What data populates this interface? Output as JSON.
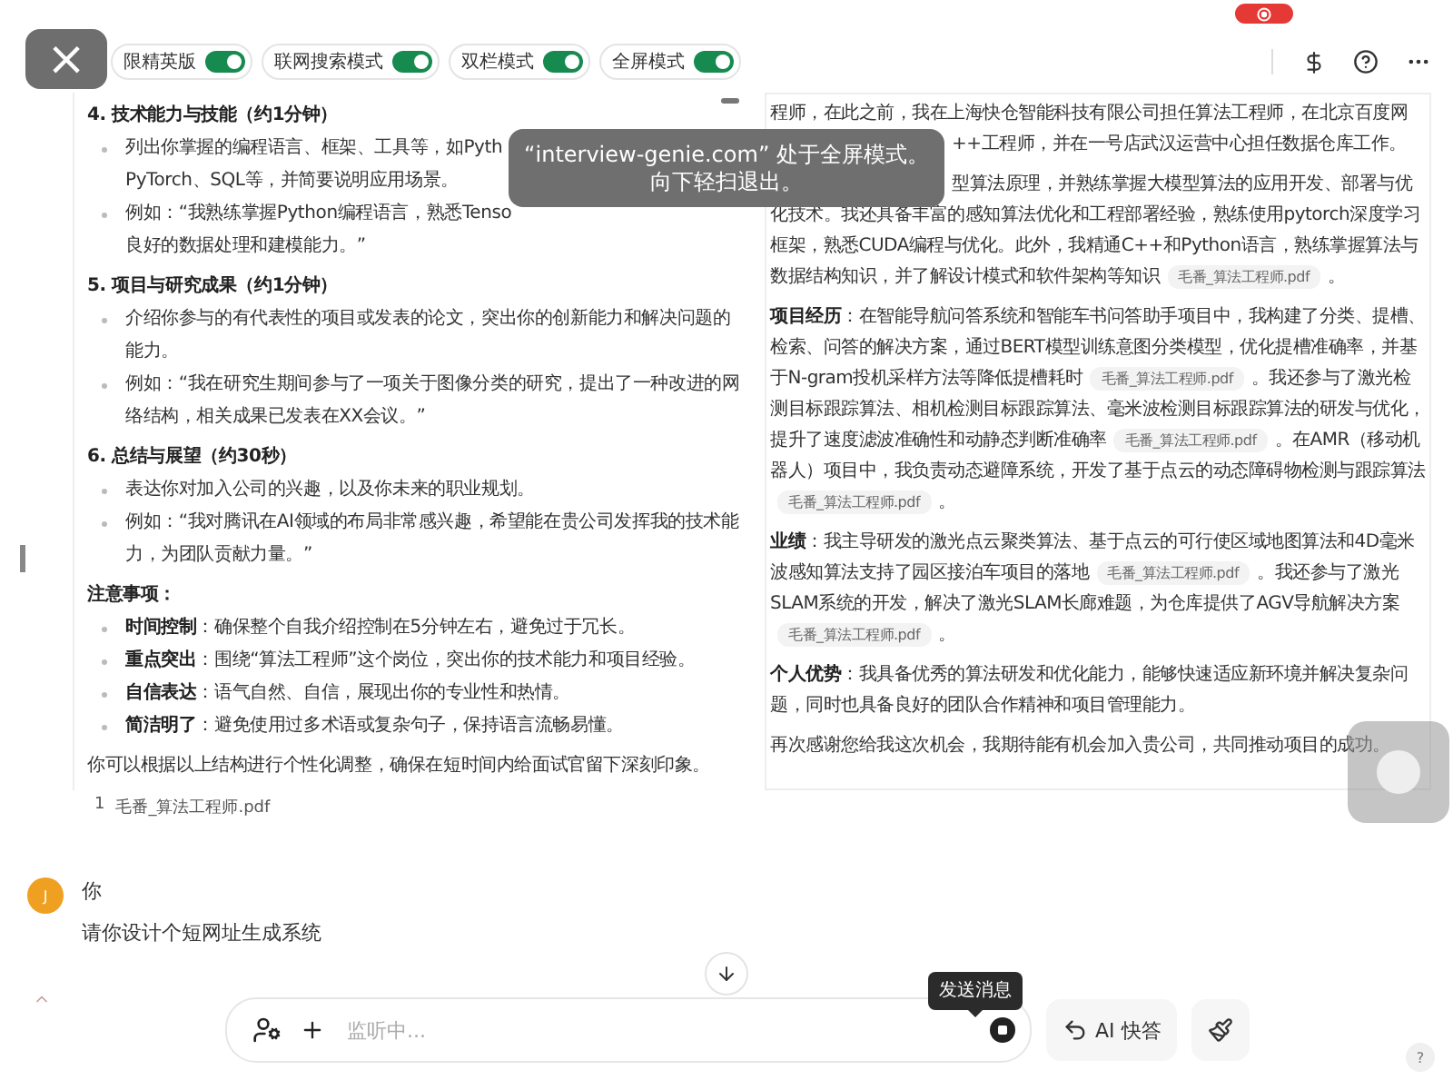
{
  "close_button": {
    "label": "×"
  },
  "toast": {
    "lines": [
      "“interview-genie.com” 处于全屏模式。",
      "向下轻扫退出。"
    ]
  },
  "toggles": [
    {
      "label": "限精英版",
      "on": true
    },
    {
      "label": "联网搜索模式",
      "on": true
    },
    {
      "label": "双栏模式",
      "on": true
    },
    {
      "label": "全屏模式",
      "on": true
    }
  ],
  "left_panel": {
    "sections": [
      {
        "heading": "4. 技术能力与技能（约1分钟）",
        "items": [
          {
            "text": "列出你掌握的编程语言、框架、工具等，如Pyth\nPyTorch、SQL等，并简要说明应用场景。"
          },
          {
            "text": "例如：“我熟练掌握Python编程语言，熟悉Tenso\n良好的数据处理和建模能力。”"
          }
        ]
      },
      {
        "heading": "5. 项目与研究成果（约1分钟）",
        "items": [
          {
            "text": "介绍你参与的有代表性的项目或发表的论文，突出你的创新能力和解决问题的能力。"
          },
          {
            "text": "例如：“我在研究生期间参与了一项关于图像分类的研究，提出了一种改进的网络结构，相关成果已发表在XX会议。”"
          }
        ]
      },
      {
        "heading": "6. 总结与展望（约30秒）",
        "items": [
          {
            "text": "表达你对加入公司的兴趣，以及你未来的职业规划。"
          },
          {
            "text": "例如：“我对腾讯在AI领域的布局非常感兴趣，希望能在贵公司发挥我的技术能力，为团队贡献力量。”"
          }
        ]
      },
      {
        "heading": "注意事项：",
        "items": [
          {
            "label": "时间控制",
            "text": "：确保整个自我介绍控制在5分钟左右，避免过于冗长。"
          },
          {
            "label": "重点突出",
            "text": "：围绕“算法工程师”这个岗位，突出你的技术能力和项目经验。"
          },
          {
            "label": "自信表达",
            "text": "：语气自然、自信，展现出你的专业性和热情。"
          },
          {
            "label": "简洁明了",
            "text": "：避免使用过多术语或复杂句子，保持语言流畅易懂。"
          }
        ]
      }
    ],
    "closing": "你可以根据以上结构进行个性化调整，确保在短时间内给面试官留下深刻印象。"
  },
  "sources": [
    {
      "index": "1",
      "file": "毛番_算法工程师.pdf"
    }
  ],
  "right_panel": {
    "paragraphs": [
      {
        "segments": [
          {
            "kind": "line",
            "text": "程师，在此之前，我在上海快仓智能科技有限公司担任算法工程师，在北京百度网"
          },
          {
            "kind": "partial",
            "text": "++工程师，并在一号店武汉运营中心担任数据仓库工作。"
          }
        ]
      },
      {
        "segments": [
          {
            "kind": "partial",
            "text": "型算法原理，并熟练掌握大模型算法的应用开发、部署与优"
          },
          {
            "kind": "text",
            "text": "化技术。我还具备丰富的感知算法优化和工程部署经验，熟练使用pytorch深度学习框架，熟悉CUDA编程与优化。此外，我精通C++和Python语言，熟练掌握算法与数据结构知识，并了解设计模式和软件架构等知识"
          },
          {
            "kind": "cite",
            "text": "毛番_算法工程师.pdf"
          },
          {
            "kind": "text",
            "text": "。"
          }
        ]
      },
      {
        "label": "项目经历",
        "segments": [
          {
            "kind": "text",
            "text": "：在智能导航问答系统和智能车书问答助手项目中，我构建了分类、提槽、检索、问答的解决方案，通过BERT模型训练意图分类模型，优化提槽准确率，并基于N-gram投机采样方法等降低提槽耗时"
          },
          {
            "kind": "cite",
            "text": "毛番_算法工程师.pdf"
          },
          {
            "kind": "text",
            "text": "。我还参与了激光检测目标跟踪算法、相机检测目标跟踪算法、毫米波检测目标跟踪算法的研发与优化，提升了速度滤波准确性和动静态判断准确率"
          },
          {
            "kind": "cite",
            "text": "毛番_算法工程师.pdf"
          },
          {
            "kind": "text",
            "text": "。在AMR（移动机器人）项目中，我负责动态避障系统，开发了基于点云的动态障碍物检测与跟踪算法"
          },
          {
            "kind": "cite",
            "text": "毛番_算法工程师.pdf"
          },
          {
            "kind": "text",
            "text": "。"
          }
        ]
      },
      {
        "label": "业绩",
        "segments": [
          {
            "kind": "text",
            "text": "：我主导研发的激光点云聚类算法、基于点云的可行使区域地图算法和4D毫米波感知算法支持了园区接泊车项目的落地"
          },
          {
            "kind": "cite",
            "text": "毛番_算法工程师.pdf"
          },
          {
            "kind": "text",
            "text": "。我还参与了激光SLAM系统的开发，解决了激光SLAM长廊难题，为仓库提供了AGV导航解决方案"
          },
          {
            "kind": "cite",
            "text": "毛番_算法工程师.pdf"
          },
          {
            "kind": "text",
            "text": "。"
          }
        ]
      },
      {
        "label": "个人优势",
        "segments": [
          {
            "kind": "text",
            "text": "：我具备优秀的算法研发和优化能力，能够快速适应新环境并解决复杂问题，同时也具备良好的团队合作精神和项目管理能力。"
          }
        ]
      },
      {
        "segments": [
          {
            "kind": "text",
            "text": "再次感谢您给我这次机会，我期待能有机会加入贵公司，共同推动项目的成功。"
          }
        ]
      }
    ]
  },
  "user_message": {
    "avatar": "J",
    "author": "你",
    "text": "请你设计个短网址生成系统"
  },
  "composer": {
    "placeholder": "监听中...",
    "tooltip": "发送消息"
  },
  "quick_answer_button": {
    "label": "AI 快答"
  },
  "help_button": {
    "label": "?"
  }
}
